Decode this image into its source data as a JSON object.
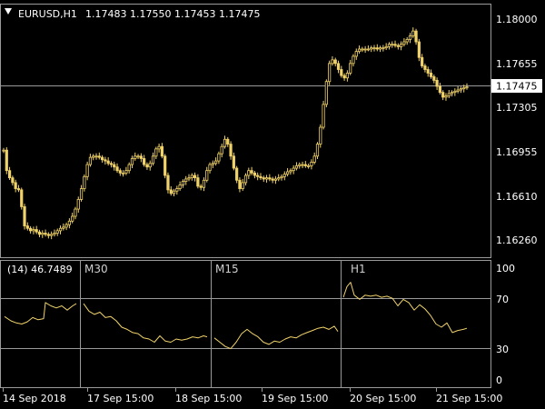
{
  "colors": {
    "background": "#000000",
    "grid": "#9a9a9a",
    "text": "#ffffff",
    "series": "#f0d26a",
    "bid_box_bg": "#ffffff",
    "bid_box_text": "#000000"
  },
  "main_chart": {
    "symbol_label": "EURUSD,H1",
    "ohlc_text": "1.17483 1.17550 1.17453 1.17475",
    "bid_price_label": "1.17475",
    "price_axis_labels": [
      "1.18000",
      "1.17655",
      "1.17305",
      "1.16955",
      "1.16610",
      "1.16260"
    ]
  },
  "indicator": {
    "header_value": "(14) 46.7489",
    "panel_labels": [
      "M30",
      "M15",
      "H1"
    ],
    "level_labels": [
      "100",
      "70",
      "30",
      "0"
    ]
  },
  "time_axis_labels": [
    "14 Sep 2018",
    "17 Sep 15:00",
    "18 Sep 15:00",
    "19 Sep 15:00",
    "20 Sep 15:00",
    "21 Sep 15:00"
  ],
  "chart_data": [
    {
      "type": "line",
      "title": "EURUSD,H1",
      "ylim": [
        1.1606,
        1.1816
      ],
      "y_ticks": [
        1.18,
        1.17655,
        1.17305,
        1.16955,
        1.1661,
        1.1626
      ],
      "current_bid": 1.17475,
      "series": [
        {
          "values": [
            1.1695,
            1.1678,
            1.1672,
            1.1668,
            1.1663,
            1.1662,
            1.1648,
            1.1632,
            1.163,
            1.1628,
            1.1629,
            1.1627,
            1.1625,
            1.1626,
            1.1625,
            1.1624,
            1.1625,
            1.1626,
            1.1628,
            1.163,
            1.1631,
            1.1633,
            1.1636,
            1.164,
            1.1646,
            1.1654,
            1.1663,
            1.1673,
            1.1683,
            1.1689,
            1.169,
            1.169,
            1.1689,
            1.1687,
            1.1686,
            1.1684,
            1.1683,
            1.1681,
            1.1678,
            1.1676,
            1.1676,
            1.1678,
            1.1683,
            1.1688,
            1.169,
            1.169,
            1.1688,
            1.1683,
            1.1681,
            1.1684,
            1.169,
            1.1696,
            1.1698,
            1.169,
            1.1674,
            1.1662,
            1.1659,
            1.1661,
            1.1663,
            1.1666,
            1.1669,
            1.1671,
            1.1672,
            1.1674,
            1.1672,
            1.1665,
            1.1664,
            1.167,
            1.1678,
            1.1683,
            1.1684,
            1.1686,
            1.1692,
            1.1698,
            1.1704,
            1.17,
            1.169,
            1.168,
            1.167,
            1.1663,
            1.1668,
            1.1674,
            1.1678,
            1.1676,
            1.1674,
            1.1673,
            1.1672,
            1.1671,
            1.1672,
            1.1671,
            1.167,
            1.1671,
            1.1672,
            1.1673,
            1.1675,
            1.1677,
            1.1678,
            1.168,
            1.1682,
            1.1683,
            1.1683,
            1.1682,
            1.1682,
            1.1685,
            1.169,
            1.17,
            1.1714,
            1.1733,
            1.1752,
            1.1767,
            1.177,
            1.1767,
            1.1762,
            1.1757,
            1.1755,
            1.1759,
            1.1767,
            1.1773,
            1.1777,
            1.1779,
            1.1779,
            1.1779,
            1.1779,
            1.178,
            1.178,
            1.1779,
            1.178,
            1.178,
            1.1781,
            1.1783,
            1.1783,
            1.1782,
            1.1781,
            1.1783,
            1.1785,
            1.1787,
            1.179,
            1.1794,
            1.1785,
            1.1772,
            1.1765,
            1.1762,
            1.1759,
            1.1756,
            1.1753,
            1.1748,
            1.1743,
            1.1739,
            1.174,
            1.1742,
            1.1743,
            1.1744,
            1.1745,
            1.1746,
            1.1747,
            1.17475
          ]
        }
      ]
    },
    {
      "type": "line",
      "title": "(14) 46.7489",
      "ylim": [
        -6,
        112
      ],
      "levels": [
        100,
        70,
        30,
        0
      ],
      "segments": [
        {
          "name": "",
          "x": [
            5,
            12,
            18,
            24,
            30,
            36,
            42,
            48,
            50,
            56,
            62,
            68,
            74,
            80,
            84
          ],
          "values": [
            60,
            56,
            54,
            53,
            55,
            59,
            57,
            58,
            73,
            70,
            68,
            70,
            66,
            70,
            72
          ]
        },
        {
          "name": "M30",
          "x": [
            92,
            98,
            104,
            110,
            116,
            122,
            128,
            134,
            140,
            146,
            152,
            158,
            164,
            170,
            176,
            182,
            188,
            194,
            200,
            206,
            212,
            218,
            224,
            228
          ],
          "values": [
            72,
            65,
            62,
            64,
            59,
            60,
            56,
            50,
            48,
            45,
            44,
            40,
            39,
            36,
            42,
            37,
            36,
            39,
            38,
            39,
            41,
            40,
            42,
            41
          ]
        },
        {
          "name": "M15",
          "x": [
            236,
            242,
            248,
            254,
            260,
            266,
            272,
            278,
            284,
            290,
            296,
            302,
            308,
            314,
            320,
            326,
            332,
            338,
            344,
            350,
            356,
            362,
            368,
            372
          ],
          "values": [
            40,
            36,
            32,
            30,
            36,
            44,
            48,
            44,
            41,
            36,
            34,
            37,
            36,
            39,
            41,
            40,
            43,
            45,
            47,
            49,
            50,
            48,
            51,
            46
          ]
        },
        {
          "name": "H1",
          "x": [
            378,
            382,
            386,
            390,
            396,
            402,
            408,
            414,
            420,
            426,
            432,
            438,
            444,
            450,
            456,
            462,
            468,
            474,
            480,
            486,
            492,
            498,
            504,
            510,
            514
          ],
          "values": [
            78,
            88,
            92,
            80,
            76,
            80,
            79,
            80,
            78,
            79,
            77,
            70,
            76,
            73,
            66,
            71,
            67,
            61,
            53,
            50,
            54,
            45,
            47,
            48,
            49
          ]
        }
      ]
    }
  ]
}
